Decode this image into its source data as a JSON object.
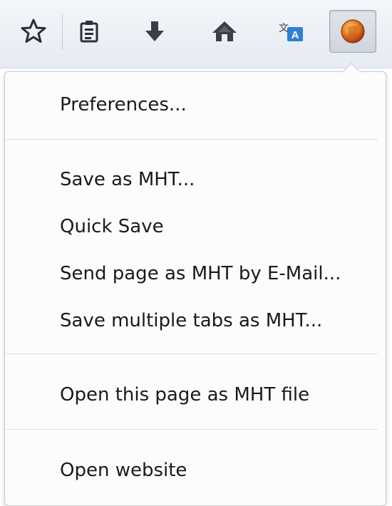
{
  "toolbar": {
    "buttons": [
      {
        "icon": "star-icon"
      },
      {
        "icon": "clipboard-icon"
      },
      {
        "icon": "download-arrow-icon"
      },
      {
        "icon": "home-icon"
      },
      {
        "icon": "translate-icon"
      },
      {
        "icon": "extension-avatar-icon",
        "active": true
      }
    ]
  },
  "menu": {
    "items": [
      {
        "label": "Preferences..."
      },
      {
        "label": "Save as MHT..."
      },
      {
        "label": "Quick Save"
      },
      {
        "label": "Send page as MHT by E-Mail..."
      },
      {
        "label": "Save multiple tabs as MHT..."
      },
      {
        "label": "Open this page as MHT file"
      },
      {
        "label": "Open website"
      }
    ]
  },
  "colors": {
    "toolbar_bg": "#e9eef4",
    "menu_bg": "#fcfcfc",
    "separator": "#dadde1",
    "text": "#1a1a1a"
  }
}
